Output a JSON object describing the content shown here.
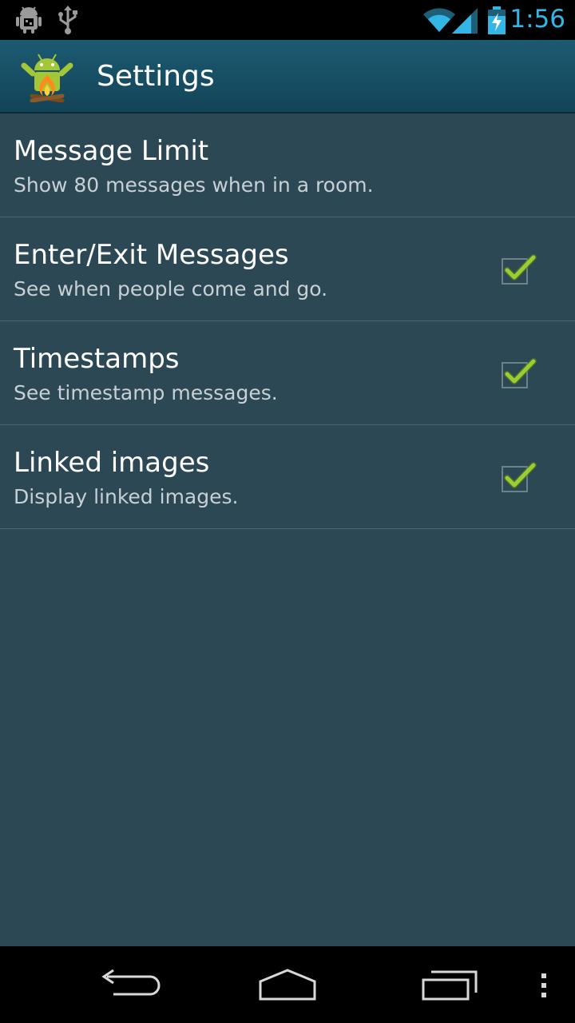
{
  "status_bar": {
    "time": "1:56",
    "left_icons": [
      "android-debug-icon",
      "usb-icon"
    ],
    "right_icons": [
      "wifi-icon",
      "cell-signal-icon",
      "battery-charging-icon"
    ],
    "accent": "#33b5e5"
  },
  "action_bar": {
    "title": "Settings",
    "app_icon": "android-campfire-icon"
  },
  "preferences": [
    {
      "title": "Message Limit",
      "summary": "Show 80 messages when in a room.",
      "has_checkbox": false
    },
    {
      "title": "Enter/Exit Messages",
      "summary": "See when people come and go.",
      "has_checkbox": true,
      "checked": true
    },
    {
      "title": "Timestamps",
      "summary": "See timestamp messages.",
      "has_checkbox": true,
      "checked": true
    },
    {
      "title": "Linked images",
      "summary": "Display linked images.",
      "has_checkbox": true,
      "checked": true
    }
  ],
  "nav_bar": {
    "buttons": [
      "back-icon",
      "home-icon",
      "recent-apps-icon",
      "menu-overflow-icon"
    ]
  },
  "colors": {
    "background": "#2d4855",
    "action_bar": "#1c5a72",
    "check": "#9acd32"
  }
}
